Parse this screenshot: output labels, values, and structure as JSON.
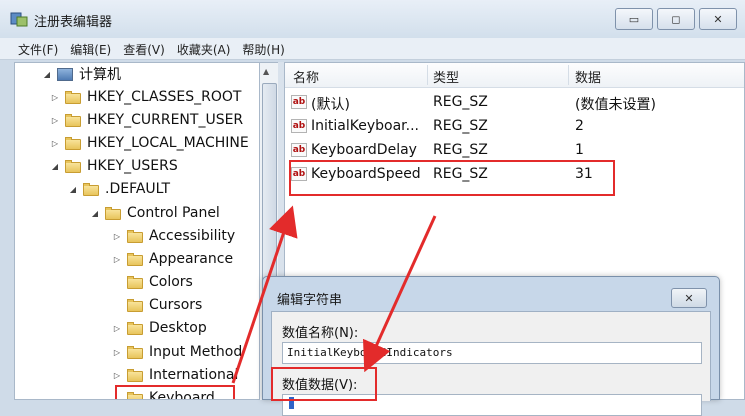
{
  "window": {
    "title": "注册表编辑器",
    "minimize": "▭",
    "maximize": "◻",
    "close": "✕"
  },
  "menu": [
    "文件(F)",
    "编辑(E)",
    "查看(V)",
    "收藏夹(A)",
    "帮助(H)"
  ],
  "tree": [
    {
      "label": "计算机",
      "expander": "◢",
      "icon": "computer-icon"
    },
    {
      "label": "HKEY_CLASSES_ROOT",
      "expander": "▷",
      "icon": "folder-icon"
    },
    {
      "label": "HKEY_CURRENT_USER",
      "expander": "▷",
      "icon": "folder-icon"
    },
    {
      "label": "HKEY_LOCAL_MACHINE",
      "expander": "▷",
      "icon": "folder-icon"
    },
    {
      "label": "HKEY_USERS",
      "expander": "◢",
      "icon": "folder-icon"
    },
    {
      "label": ".DEFAULT",
      "expander": "◢",
      "icon": "folder-icon"
    },
    {
      "label": "Control Panel",
      "expander": "◢",
      "icon": "folder-icon"
    },
    {
      "label": "Accessibility",
      "expander": "▷",
      "icon": "folder-icon"
    },
    {
      "label": "Appearance",
      "expander": "▷",
      "icon": "folder-icon"
    },
    {
      "label": "Colors",
      "expander": "",
      "icon": "folder-icon"
    },
    {
      "label": "Cursors",
      "expander": "",
      "icon": "folder-icon"
    },
    {
      "label": "Desktop",
      "expander": "▷",
      "icon": "folder-icon"
    },
    {
      "label": "Input Method",
      "expander": "▷",
      "icon": "folder-icon"
    },
    {
      "label": "International",
      "expander": "▷",
      "icon": "folder-icon"
    },
    {
      "label": "Keyboard",
      "expander": "",
      "icon": "folder-icon"
    }
  ],
  "list": {
    "headers": {
      "name": "名称",
      "type": "类型",
      "data": "数据"
    },
    "rows": [
      {
        "name": "(默认)",
        "type": "REG_SZ",
        "data": "(数值未设置)"
      },
      {
        "name": "InitialKeyboar...",
        "type": "REG_SZ",
        "data": "2"
      },
      {
        "name": "KeyboardDelay",
        "type": "REG_SZ",
        "data": "1"
      },
      {
        "name": "KeyboardSpeed",
        "type": "REG_SZ",
        "data": "31"
      }
    ],
    "value_icon": "ab"
  },
  "dialog": {
    "title": "编辑字符串",
    "close": "✕",
    "name_label": "数值名称(N):",
    "name_value": "InitialKeyboardIndicators",
    "data_label": "数值数据(V):",
    "data_value": ""
  },
  "colors": {
    "highlight": "#e32b2b",
    "accent": "#2f64c8"
  }
}
